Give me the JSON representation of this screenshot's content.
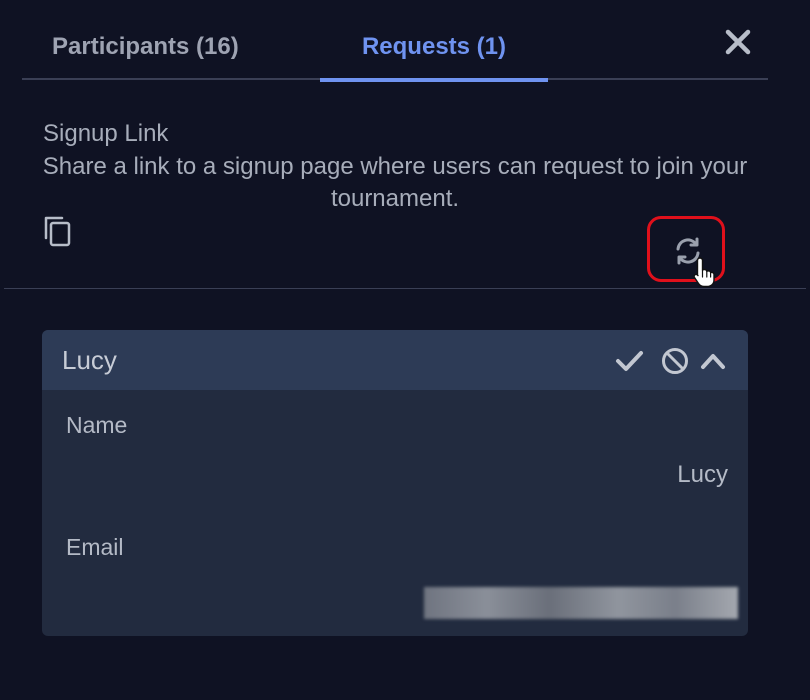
{
  "tabs": {
    "participants_label": "Participants (16)",
    "requests_label": "Requests (1)"
  },
  "signup": {
    "label": "Signup Link",
    "description": "Share a link to a signup page where users can request to join your tournament."
  },
  "request_card": {
    "title": "Lucy",
    "name_label": "Name",
    "name_value": "Lucy",
    "email_label": "Email",
    "email_value": ""
  },
  "icons": {
    "close": "close-icon",
    "copy": "copy-icon",
    "refresh": "refresh-icon",
    "approve": "checkmark-icon",
    "reject": "block-icon",
    "collapse": "chevron-up-icon",
    "cursor": "hand-pointer-icon"
  },
  "colors": {
    "background": "#0f1223",
    "active_tab": "#6f93f0",
    "card_header": "#2d3b56",
    "card_body": "#222b3f",
    "highlight": "#e0101b"
  }
}
